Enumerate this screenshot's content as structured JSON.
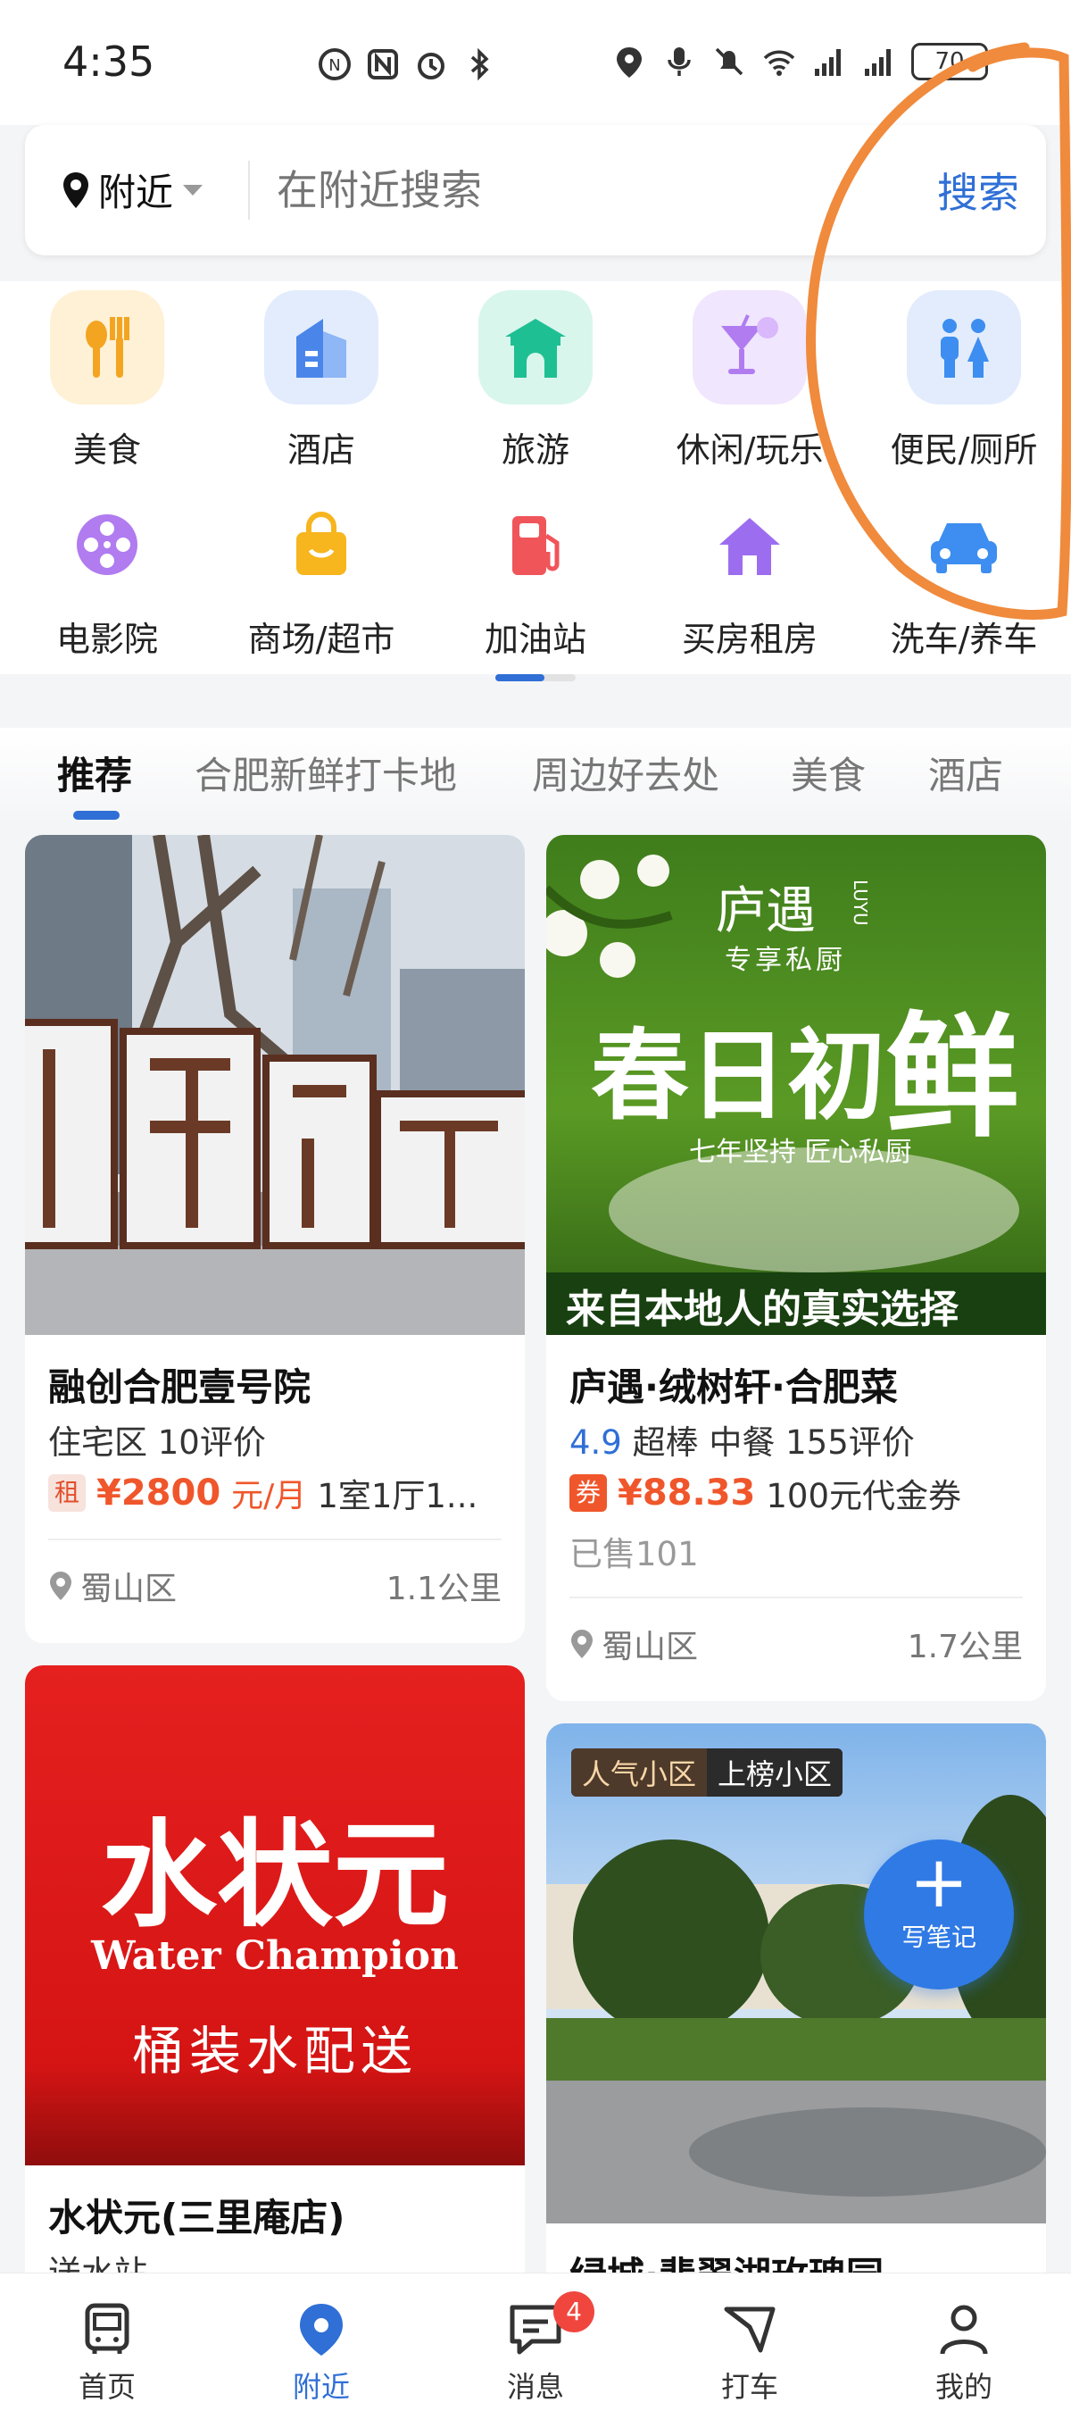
{
  "status_bar": {
    "time": "4:35",
    "battery": "70"
  },
  "search": {
    "location": "附近",
    "placeholder": "在附近搜索",
    "button": "搜索"
  },
  "categories": [
    {
      "label": "美食",
      "icon": "food-icon",
      "color": "#f3a522"
    },
    {
      "label": "酒店",
      "icon": "hotel-icon",
      "color": "#4a86ea"
    },
    {
      "label": "旅游",
      "icon": "travel-icon",
      "color": "#1fbf94"
    },
    {
      "label": "休闲/玩乐",
      "icon": "cocktail-icon",
      "color": "#b07cf0"
    },
    {
      "label": "便民/厕所",
      "icon": "restroom-icon",
      "color": "#3d8ef0"
    },
    {
      "label": "电影院",
      "icon": "film-reel-icon",
      "color": "#b07cf0"
    },
    {
      "label": "商场/超市",
      "icon": "shopping-bag-icon",
      "color": "#f7b51e"
    },
    {
      "label": "加油站",
      "icon": "gas-pump-icon",
      "color": "#f0555a"
    },
    {
      "label": "买房租房",
      "icon": "house-icon",
      "color": "#9d6df0"
    },
    {
      "label": "洗车/养车",
      "icon": "car-icon",
      "color": "#3d8ef0"
    }
  ],
  "feed_tabs": [
    "推荐",
    "合肥新鲜打卡地",
    "周边好去处",
    "美食",
    "酒店"
  ],
  "cards": {
    "card1": {
      "title": "融创合肥壹号院",
      "line": "住宅区  10评价",
      "tag": "租",
      "price": "¥2800",
      "unit": "元/月",
      "desc": "1室1厅1...",
      "district": "蜀山区",
      "distance": "1.1公里"
    },
    "card2": {
      "brand_cn": "庐遇",
      "brand_en": "LUYU",
      "brand_sub": "专享私厨",
      "headline_a": "春日初",
      "headline_b": "鲜",
      "slogan": "七年坚持 匠心私厨",
      "banner": "来自本地人的真实选择",
      "title": "庐遇·绒树轩·合肥菜",
      "rating": "4.9",
      "rating_text": "超棒  中餐  155评价",
      "tag": "券",
      "price": "¥88.33",
      "desc": "100元代金券",
      "sold": "已售101",
      "district": "蜀山区",
      "distance": "1.7公里"
    },
    "card3": {
      "logo": "水状元",
      "logo_en": "Water Champion",
      "sub": "桶装水配送",
      "title": "水状元(三里庵店)",
      "line": "送水站"
    },
    "card4": {
      "badge1": "人气小区",
      "badge2": "上榜小区",
      "title": "绿城·翡翠湖玫瑰园"
    }
  },
  "fab": {
    "label": "写笔记"
  },
  "bottom_nav": [
    {
      "label": "首页",
      "icon": "home-bus-icon"
    },
    {
      "label": "附近",
      "icon": "location-pin-icon"
    },
    {
      "label": "消息",
      "icon": "message-icon",
      "badge": "4"
    },
    {
      "label": "打车",
      "icon": "taxi-icon"
    },
    {
      "label": "我的",
      "icon": "profile-icon"
    }
  ],
  "colors": {
    "accent": "#2f6fd6",
    "price": "#f0562b",
    "annotation": "#f08a3c"
  }
}
